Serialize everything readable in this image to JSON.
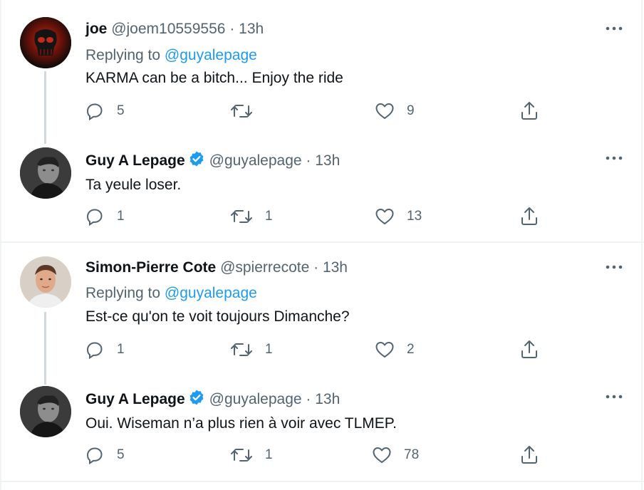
{
  "colors": {
    "accent": "#1d9bf0",
    "text": "#0f1419",
    "muted": "#536471",
    "divider": "#eff3f4"
  },
  "icons": {
    "reply": "reply-icon",
    "retweet": "retweet-icon",
    "like": "heart-icon",
    "share": "share-icon",
    "more": "more-icon",
    "verified": "verified-badge-icon"
  },
  "tweets": [
    {
      "name": "joe",
      "handle": "@joem10559556",
      "separator": "·",
      "time": "13h",
      "replying_prefix": "Replying to",
      "replying_to": "@guyalepage",
      "text": "KARMA can be a bitch... Enjoy the ride",
      "replies": "5",
      "retweets": "",
      "likes": "9"
    },
    {
      "name": "Guy A Lepage",
      "handle": "@guyalepage",
      "separator": "·",
      "time": "13h",
      "text": "Ta yeule loser.",
      "replies": "1",
      "retweets": "1",
      "likes": "13"
    },
    {
      "name": "Simon-Pierre Cote",
      "handle": "@spierrecote",
      "separator": "·",
      "time": "13h",
      "replying_prefix": "Replying to",
      "replying_to": "@guyalepage",
      "text": "Est-ce qu'on te voit toujours Dimanche?",
      "replies": "1",
      "retweets": "1",
      "likes": "2"
    },
    {
      "name": "Guy A Lepage",
      "handle": "@guyalepage",
      "separator": "·",
      "time": "13h",
      "text": "Oui. Wiseman n’a plus rien à voir avec TLMEP.",
      "replies": "5",
      "retweets": "1",
      "likes": "78"
    }
  ]
}
